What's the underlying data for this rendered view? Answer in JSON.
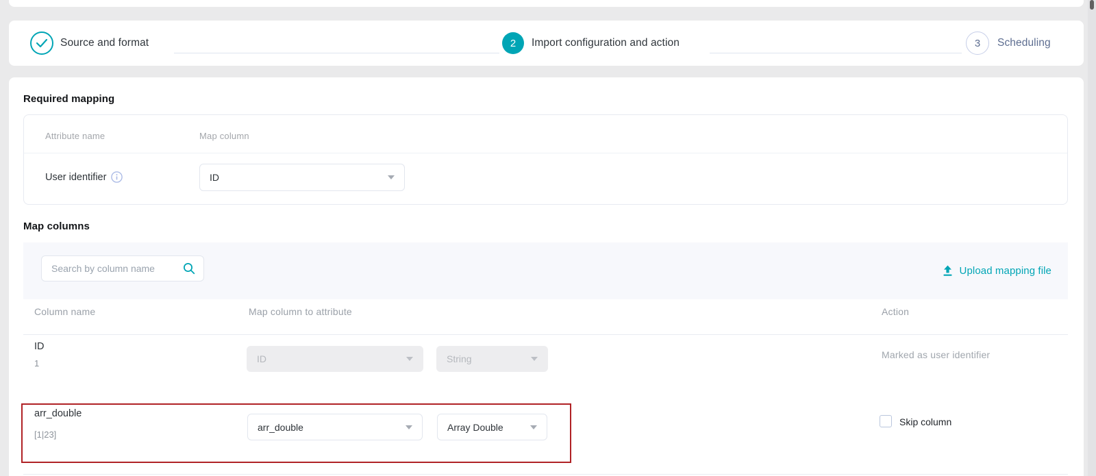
{
  "stepper": {
    "steps": [
      {
        "label": "Source and format",
        "state": "completed",
        "icon": "check-icon"
      },
      {
        "number": "2",
        "label": "Import configuration and action",
        "state": "current"
      },
      {
        "number": "3",
        "label": "Scheduling",
        "state": "upcoming"
      }
    ]
  },
  "required_mapping": {
    "title": "Required mapping",
    "columns": {
      "attribute_name": "Attribute name",
      "map_column": "Map column"
    },
    "row": {
      "label": "User identifier",
      "map_column_value": "ID"
    }
  },
  "map_columns": {
    "title": "Map columns",
    "search": {
      "placeholder": "Search by column name",
      "icon": "search-icon"
    },
    "upload": {
      "label": "Upload mapping file",
      "icon": "upload-icon"
    },
    "table": {
      "headers": {
        "column_name": "Column name",
        "map_attribute": "Map column to attribute",
        "action": "Action"
      },
      "rows": [
        {
          "column_name": "ID",
          "sample_value": "1",
          "attribute": "ID",
          "data_type": "String",
          "disabled": true,
          "action_text": "Marked as user identifier"
        },
        {
          "column_name": "arr_double",
          "sample_value": "[1|23]",
          "attribute": "arr_double",
          "data_type": "Array Double",
          "disabled": false,
          "highlighted": true,
          "checkbox_checked": false,
          "action_checkbox_label": "Skip column"
        }
      ]
    }
  },
  "colors": {
    "accent_teal": "#00a5b5",
    "highlight_red": "#b02125",
    "step_inactive_text": "#5d6d90"
  }
}
